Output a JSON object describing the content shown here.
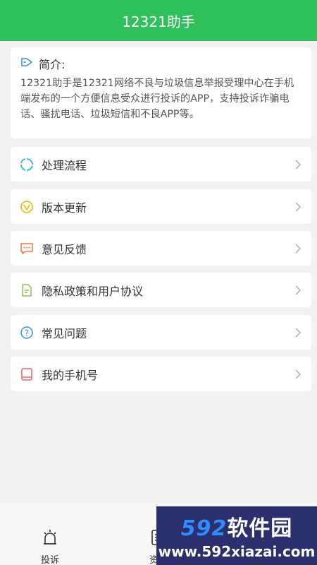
{
  "header": {
    "title": "12321助手"
  },
  "intro": {
    "title": "简介:",
    "text": "12321助手是12321网络不良与垃圾信息举报受理中心在手机端发布的一个方便信息受众进行投诉的APP，支持投诉诈骗电话、骚扰电话、垃圾短信和不良APP等。"
  },
  "menu": [
    {
      "label": "处理流程",
      "icon": "process-icon",
      "color": "#29b6d8"
    },
    {
      "label": "版本更新",
      "icon": "update-icon",
      "color": "#f0b400"
    },
    {
      "label": "意见反馈",
      "icon": "feedback-icon",
      "color": "#f07a3a"
    },
    {
      "label": "隐私政策和用户协议",
      "icon": "document-icon",
      "color": "#8bc34a"
    },
    {
      "label": "常见问题",
      "icon": "question-icon",
      "color": "#3a8fe0"
    },
    {
      "label": "我的手机号",
      "icon": "phone-icon",
      "color": "#f06060"
    }
  ],
  "tabs": [
    {
      "label": "投诉",
      "icon": "alarm-icon"
    },
    {
      "label": "资讯",
      "icon": "news-icon"
    }
  ],
  "watermark": {
    "brand_number": "592",
    "brand_text": "软件园",
    "url": "www.592xiazai.com"
  },
  "colors": {
    "primary": "#2ec05a",
    "background": "#f2f2f2"
  }
}
